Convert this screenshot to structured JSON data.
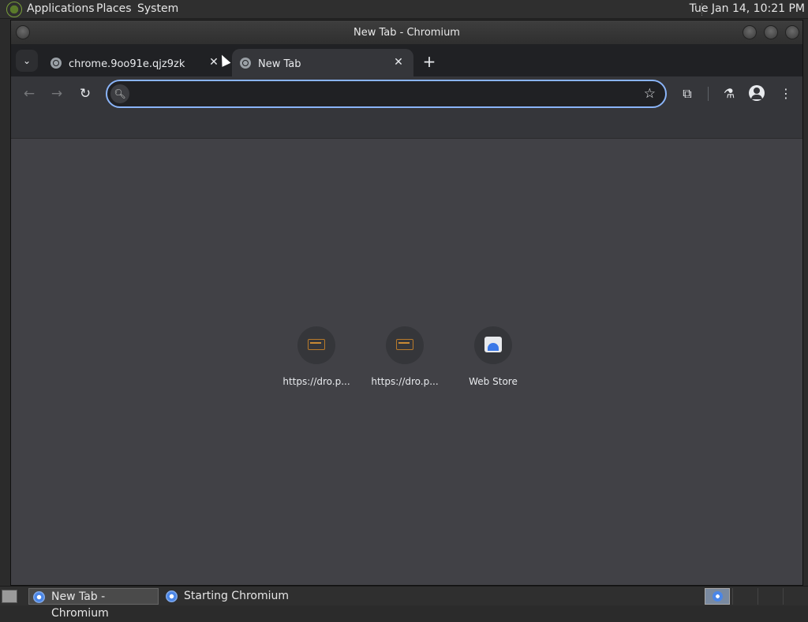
{
  "top_panel": {
    "menus": [
      "Applications",
      "Places",
      "System"
    ],
    "clock": "Tue Jan 14, 10:21 PM"
  },
  "window": {
    "title": "New Tab - Chromium"
  },
  "tabs": [
    {
      "label": "chrome.9oo91e.qjz9zk",
      "close": "✕",
      "active": false
    },
    {
      "label": "New Tab",
      "close": "✕",
      "active": true
    }
  ],
  "tab_strip": {
    "search_icon": "⌄",
    "new_tab": "+"
  },
  "toolbar": {
    "back": "←",
    "forward": "→",
    "reload": "↻",
    "omnibox_value": "",
    "omnibox_placeholder": "",
    "star": "☆",
    "extensions": "⧉",
    "labs": "⚗",
    "menu": "⋮"
  },
  "shortcuts": [
    {
      "label": "https://dro.p...",
      "icon": "drop-favicon"
    },
    {
      "label": "https://dro.p...",
      "icon": "drop-favicon"
    },
    {
      "label": "Web Store",
      "icon": "web-store-icon"
    }
  ],
  "taskbar": {
    "tasks": [
      "New Tab - Chromium",
      "Starting Chromium"
    ]
  }
}
